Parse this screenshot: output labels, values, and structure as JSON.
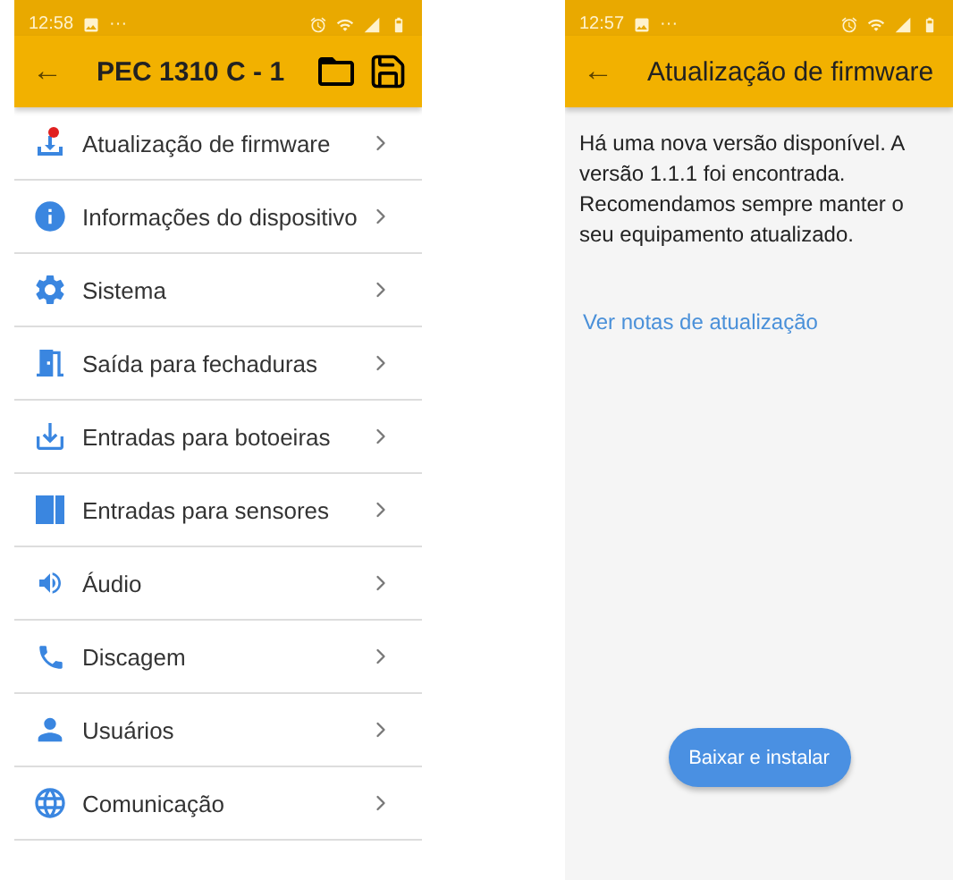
{
  "left_screen": {
    "status_bar": {
      "time": "12:58",
      "extra": "···"
    },
    "app_bar": {
      "back": "←",
      "title": "PEC 1310 C - 1"
    },
    "menu": [
      {
        "kind": "firmware",
        "label": "Atualização de firmware"
      },
      {
        "kind": "info",
        "label": "Informações do dispositivo"
      },
      {
        "kind": "system",
        "label": "Sistema"
      },
      {
        "kind": "door",
        "label": "Saída para fechaduras"
      },
      {
        "kind": "input",
        "label": "Entradas para botoeiras"
      },
      {
        "kind": "sensor",
        "label": "Entradas para sensores"
      },
      {
        "kind": "audio",
        "label": "Áudio"
      },
      {
        "kind": "phone",
        "label": "Discagem"
      },
      {
        "kind": "user",
        "label": "Usuários"
      },
      {
        "kind": "globe",
        "label": "Comunicação"
      }
    ]
  },
  "right_screen": {
    "status_bar": {
      "time": "12:57",
      "extra": "···"
    },
    "app_bar": {
      "back": "←",
      "title": "Atualização de firmware"
    },
    "message": "Há uma nova versão disponível. A versão 1.1.1 foi encontrada. Recomendamos sempre manter o seu equipamento atualizado.",
    "link": "Ver notas de atualização",
    "button": "Baixar e instalar"
  }
}
